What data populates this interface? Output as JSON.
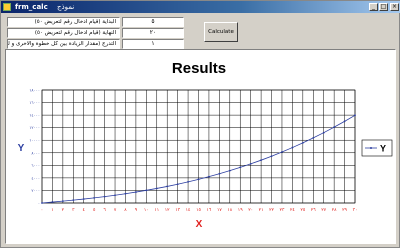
{
  "window": {
    "title": "frm_calc",
    "title_rtl": "نموذج",
    "buttons": [
      "_",
      "□",
      "×"
    ]
  },
  "inputs": [
    {
      "value": "٥",
      "label": "البداية (قيام ادخال رقم لتعريض ٥٠)"
    },
    {
      "value": "٢٠",
      "label": "النهاية (قيام ادخال رقم لتعريض ٥٠)"
    },
    {
      "value": "١",
      "label": "التدرج (مقدار الزيادة بين كل خطوة والاخرى و لتعريض ١)"
    }
  ],
  "calculate_button": "Calculate",
  "colors": {
    "series": "#2c3ea0",
    "axis_label": "#e0201e",
    "grid": "#000000"
  },
  "chart_data": {
    "type": "line",
    "title": "Results",
    "xlabel": "X",
    "ylabel": "Y",
    "legend": [
      "Y"
    ],
    "legend_position": "right",
    "grid": true,
    "x": [
      0,
      1,
      2,
      3,
      4,
      5,
      6,
      7,
      8,
      9,
      10,
      11,
      12,
      13,
      14,
      15,
      16,
      17,
      18,
      19,
      20,
      21,
      22,
      23,
      24,
      25,
      26,
      27,
      28,
      29,
      30
    ],
    "x_tick_labels": [
      "٠",
      "١",
      "٢",
      "٣",
      "٤",
      "٥",
      "٦",
      "٧",
      "٨",
      "٩",
      "١٠",
      "١١",
      "١٢",
      "١٣",
      "١٤",
      "١٥",
      "١٦",
      "١٧",
      "١٨",
      "١٩",
      "٢٠",
      "٢١",
      "٢٢",
      "٢٣",
      "٢٤",
      "٢٥",
      "٢٦",
      "٢٧",
      "٢٨",
      "٢٩",
      "٣٠"
    ],
    "y_tick_labels": [
      "٠",
      "٢٠٠٠",
      "٤٠٠٠",
      "٦٠٠٠",
      "٨٠٠٠",
      "١٠٠٠٠",
      "١٢٠٠٠",
      "١٤٠٠٠",
      "١٦٠٠٠",
      "١٨٠٠٠"
    ],
    "ylim": [
      0,
      18000
    ],
    "xlim": [
      0,
      30
    ],
    "y": [
      0,
      150,
      300,
      460,
      630,
      820,
      1020,
      1240,
      1480,
      1740,
      2020,
      2320,
      2640,
      2990,
      3370,
      3770,
      4200,
      4660,
      5150,
      5670,
      6230,
      6820,
      7450,
      8120,
      8830,
      9580,
      10370,
      11200,
      12080,
      13000,
      13970
    ]
  }
}
